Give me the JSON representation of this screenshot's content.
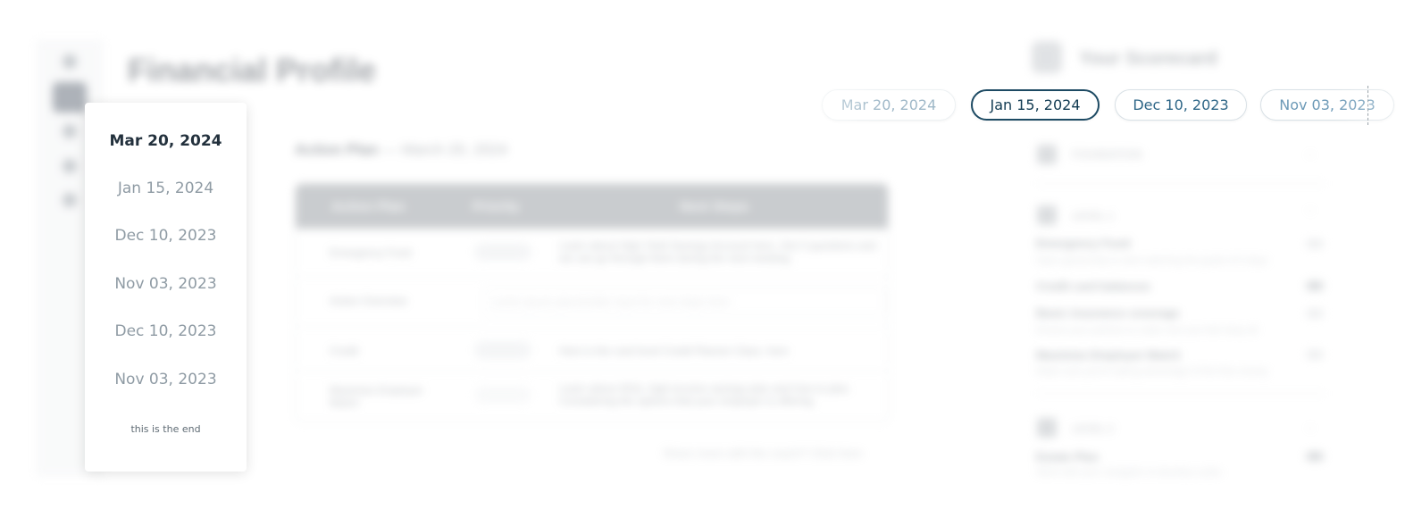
{
  "background": {
    "page_title": "Financial Profile",
    "action_plan": {
      "label": "Action Plan",
      "date": "— March 20, 2024"
    },
    "table": {
      "headers": [
        "Action Plan",
        "Priority",
        "Next Steps"
      ],
      "rows": [
        {
          "name": "Emergency Fund",
          "priority": "NEW",
          "steps": "Learn about High Yield Savings Account here. Get 3 questions and we can go through them during the next meeting."
        },
        {
          "name": "Action Overview",
          "priority": "",
          "steps": "Lorem ipsum placeholder input for next steps here"
        },
        {
          "name": "Credit",
          "priority": "NEW",
          "steps": "Here is the card level Credit Planner Class. here"
        },
        {
          "name": "Maximize Employer Match",
          "priority": "",
          "steps": "Learn about 401k, high-income savings plan and how to plan. Considering the options that your employer is offering."
        }
      ],
      "footer_note": "Share more with the coach? Click here"
    },
    "scorecard": {
      "title": "Your Scorecard",
      "foundation": "FOUNDATION",
      "level1": "LEVEL 1",
      "level1_items": [
        {
          "title": "Emergency Fund",
          "desc": "Open generosity to start watching the goals of 6 days"
        },
        {
          "title": "Credit card balances",
          "desc": ""
        },
        {
          "title": "Basic insurance coverage",
          "desc": "Ensure your policies to make sure you feel okay all"
        },
        {
          "title": "Maximize Employer Match",
          "desc": "Make sure you're taking advantage of the free money"
        }
      ],
      "level2": "LEVEL 2",
      "level2_items": [
        {
          "title": "Estate Plan",
          "desc": "Work with your navigator to develop a plan"
        }
      ]
    }
  },
  "date_pills": {
    "items": [
      "Mar 20, 2024",
      "Jan 15, 2024",
      "Dec 10, 2023",
      "Nov 03, 2023"
    ],
    "selected": "Jan 15, 2024"
  },
  "date_picker": {
    "options": [
      "Mar 20, 2024",
      "Jan 15, 2024",
      "Dec 10, 2023",
      "Nov 03, 2023",
      "Dec 10, 2023",
      "Nov 03, 2023"
    ],
    "selected": "Mar 20, 2024",
    "end_text": "this is the end"
  },
  "colors": {
    "accent": "#1d4a63",
    "pill_text": "#2e6687",
    "muted": "#8f9ba4"
  }
}
